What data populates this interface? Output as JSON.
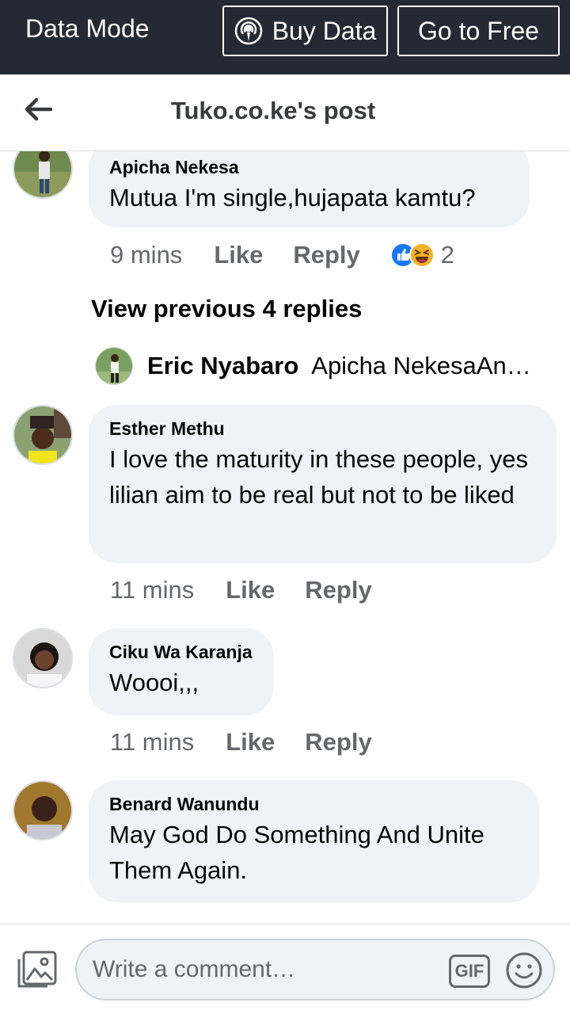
{
  "databar": {
    "mode": "Data Mode",
    "buy_label": "Buy Data",
    "free_label": "Go to Free"
  },
  "header": {
    "title": "Tuko.co.ke's post"
  },
  "comments": [
    {
      "name": "Apicha Nekesa",
      "text": "Mutua I'm single,hujapata kamtu?",
      "time": "9 mins",
      "like": "Like",
      "reply": "Reply",
      "reactions": "2"
    },
    {
      "name": "Esther Methu",
      "text": "I love the maturity in these people, yes lilian aim to be real but not to be liked",
      "time": "11 mins",
      "like": "Like",
      "reply": "Reply"
    },
    {
      "name": "Ciku Wa Karanja",
      "text": "Woooi,,,",
      "time": "11 mins",
      "like": "Like",
      "reply": "Reply"
    },
    {
      "name": "Benard Wanundu",
      "text": "May God Do Something And Unite Them Again."
    }
  ],
  "view_previous": "View previous 4 replies",
  "reply_preview": {
    "name": "Eric Nyabaro",
    "text": "Apicha NekesaAnd you're still single"
  },
  "composer": {
    "placeholder": "Write a comment…",
    "gif_label": "GIF"
  },
  "colors": {
    "banner": "#242a33",
    "bubble": "#f0f2f5",
    "like_blue": "#1877f2",
    "haha_yellow": "#f7b125"
  }
}
